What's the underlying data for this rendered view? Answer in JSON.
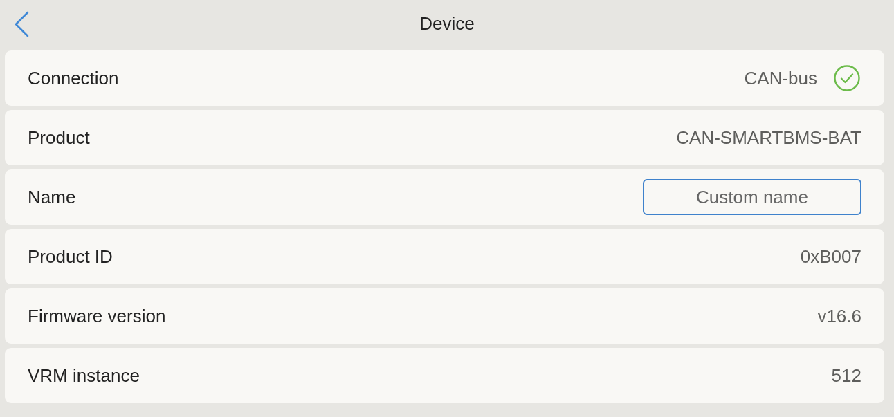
{
  "header": {
    "title": "Device"
  },
  "rows": [
    {
      "kind": "status",
      "label": "Connection",
      "value": "CAN-bus",
      "ok": true
    },
    {
      "kind": "text",
      "label": "Product",
      "value": "CAN-SMARTBMS-BAT"
    },
    {
      "kind": "input",
      "label": "Name",
      "placeholder": "Custom name"
    },
    {
      "kind": "text",
      "label": "Product ID",
      "value": "0xB007"
    },
    {
      "kind": "text",
      "label": "Firmware version",
      "value": "v16.6"
    },
    {
      "kind": "text",
      "label": "VRM instance",
      "value": "512"
    }
  ]
}
